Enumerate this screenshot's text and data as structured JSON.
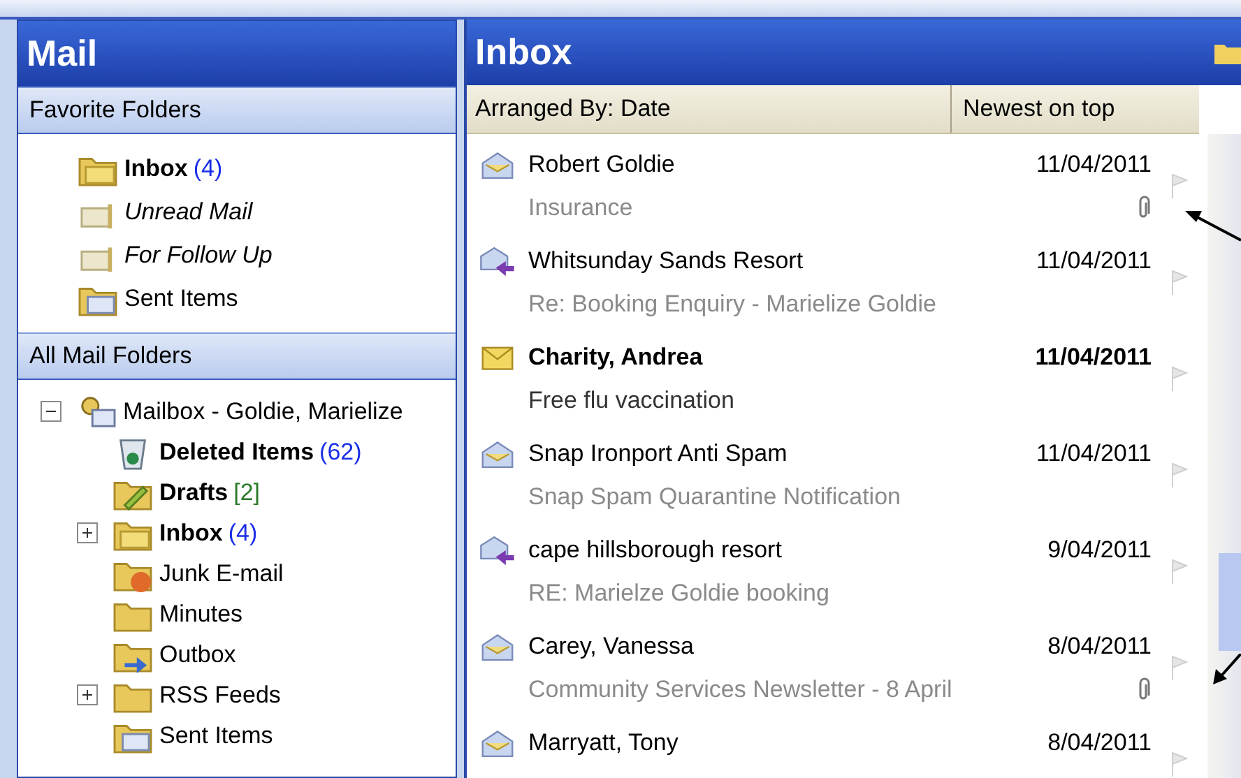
{
  "navigation": {
    "title": "Mail",
    "favorites": {
      "title": "Favorite Folders",
      "items": [
        {
          "name": "Inbox",
          "count": "(4)",
          "color": "#1a2ee8",
          "bold": true,
          "italic": false,
          "kind": "inbox"
        },
        {
          "name": "Unread Mail",
          "bold": false,
          "italic": true,
          "kind": "search"
        },
        {
          "name": "For Follow Up",
          "bold": false,
          "italic": true,
          "kind": "search"
        },
        {
          "name": "Sent Items",
          "bold": false,
          "italic": false,
          "kind": "sent"
        }
      ]
    },
    "all_folders": {
      "title": "All Mail Folders",
      "tree": [
        {
          "name": "Mailbox - Goldie, Marielize",
          "bold": false,
          "kind": "mailbox",
          "expanded": true,
          "children": [
            {
              "name": "Deleted Items",
              "count": "(62)",
              "color": "#1a2ee8",
              "bold": true,
              "kind": "trash"
            },
            {
              "name": "Drafts",
              "count": "[2]",
              "color": "#2a7a2a",
              "bold": true,
              "kind": "drafts"
            },
            {
              "name": "Inbox",
              "count": "(4)",
              "color": "#1a2ee8",
              "bold": true,
              "kind": "inbox",
              "expanded": false
            },
            {
              "name": "Junk E-mail",
              "bold": false,
              "kind": "junk"
            },
            {
              "name": "Minutes",
              "bold": false,
              "kind": "folder"
            },
            {
              "name": "Outbox",
              "bold": false,
              "kind": "outbox"
            },
            {
              "name": "RSS Feeds",
              "bold": false,
              "kind": "folder",
              "expanded": false
            },
            {
              "name": "Sent Items",
              "bold": false,
              "kind": "sent"
            }
          ]
        }
      ]
    }
  },
  "inbox": {
    "title": "Inbox",
    "arranged_by": "Arranged By: Date",
    "sort_order": "Newest on top",
    "messages": [
      {
        "kind": "read",
        "sender": "Robert Goldie",
        "date": "11/04/2011",
        "subject": "Insurance",
        "attachment": true
      },
      {
        "kind": "replied",
        "sender": "Whitsunday Sands Resort",
        "date": "11/04/2011",
        "subject": "Re: Booking Enquiry - Marielize Goldie",
        "attachment": false
      },
      {
        "kind": "unread",
        "sender": "Charity, Andrea",
        "date": "11/04/2011",
        "subject": "Free flu vaccination",
        "attachment": false
      },
      {
        "kind": "read",
        "sender": "Snap Ironport Anti Spam",
        "date": "11/04/2011",
        "subject": "Snap Spam Quarantine Notification",
        "attachment": false
      },
      {
        "kind": "replied",
        "sender": "cape hillsborough resort",
        "date": "9/04/2011",
        "subject": "RE: Marielze Goldie booking",
        "attachment": false
      },
      {
        "kind": "read",
        "sender": "Carey, Vanessa",
        "date": "8/04/2011",
        "subject": "Community Services Newsletter - 8 April",
        "attachment": true
      },
      {
        "kind": "read",
        "sender": "Marryatt, Tony",
        "date": "8/04/2011",
        "attachment": false
      }
    ]
  }
}
